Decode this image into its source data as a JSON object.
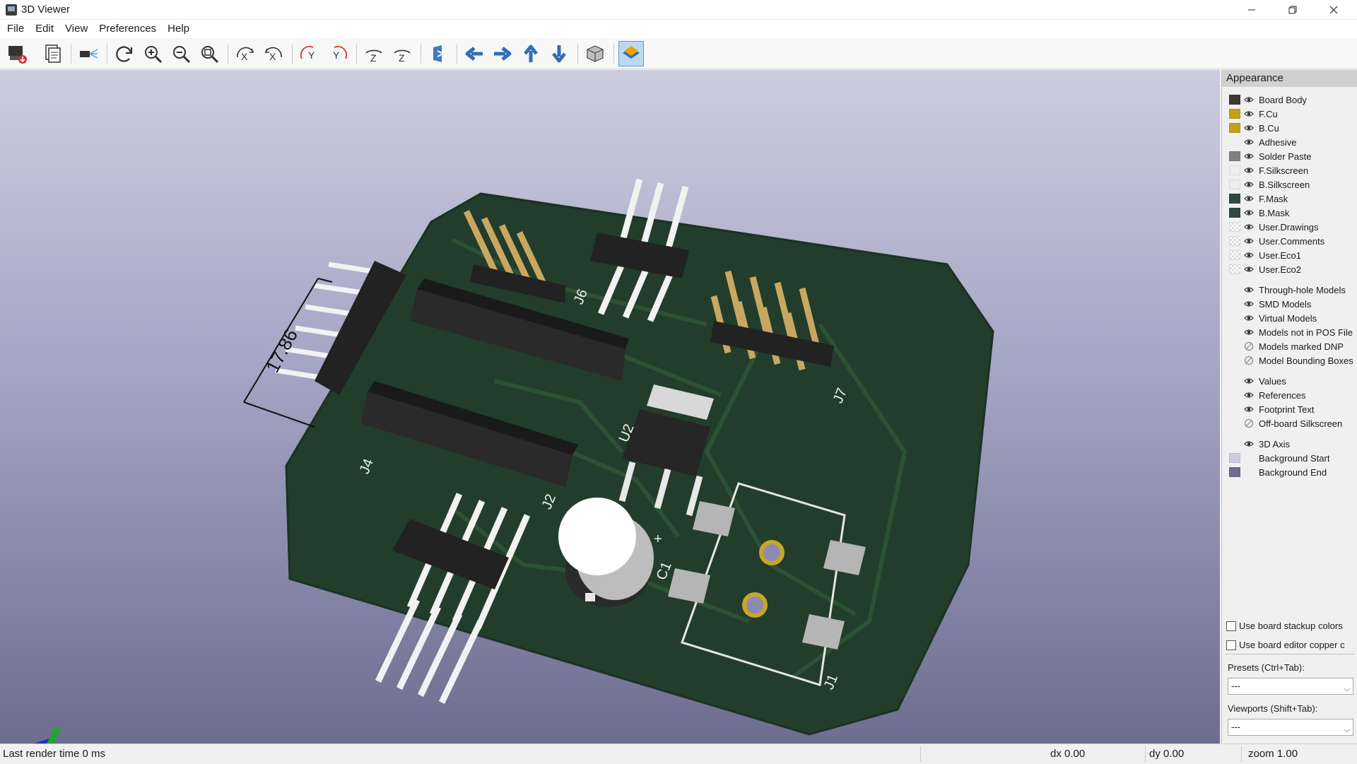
{
  "window": {
    "title": "3D Viewer"
  },
  "menu": [
    "File",
    "Edit",
    "View",
    "Preferences",
    "Help"
  ],
  "toolbar": {
    "buttons": [
      "render-raytraced-icon",
      "copy-image-icon",
      "camera-icon",
      "reload-icon",
      "zoom-in-icon",
      "zoom-out-icon",
      "zoom-fit-icon",
      "rotate-x-cw-icon",
      "rotate-x-ccw-icon",
      "rotate-y-cw-icon",
      "rotate-y-ccw-icon",
      "rotate-z-cw-icon",
      "rotate-z-ccw-icon",
      "flip-board-icon",
      "pan-left-icon",
      "pan-right-icon",
      "pan-up-icon",
      "pan-down-icon",
      "orthographic-icon",
      "layers-manager-icon"
    ]
  },
  "viewport": {
    "dimension_label": "17.86",
    "references": [
      "J6",
      "J7",
      "J4",
      "U2",
      "J2",
      "C1",
      "J1"
    ],
    "cap_polarity": "+"
  },
  "appearance": {
    "title": "Appearance",
    "layers": [
      {
        "name": "Board Body",
        "color": "#3e3a32"
      },
      {
        "name": "F.Cu",
        "color": "#c2a11c"
      },
      {
        "name": "B.Cu",
        "color": "#c2a11c"
      },
      {
        "name": "Adhesive",
        "color": ""
      },
      {
        "name": "Solder Paste",
        "color": "#808080"
      },
      {
        "name": "F.Silkscreen",
        "color": "#eeeeee"
      },
      {
        "name": "B.Silkscreen",
        "color": "#eeeeee"
      },
      {
        "name": "F.Mask",
        "color": "#2e4a3e"
      },
      {
        "name": "B.Mask",
        "color": "#2e4a3e"
      },
      {
        "name": "User.Drawings",
        "color": "checker"
      },
      {
        "name": "User.Comments",
        "color": "checker"
      },
      {
        "name": "User.Eco1",
        "color": "checker"
      },
      {
        "name": "User.Eco2",
        "color": "checker"
      }
    ],
    "models": [
      {
        "name": "Through-hole Models",
        "visible": true
      },
      {
        "name": "SMD Models",
        "visible": true
      },
      {
        "name": "Virtual Models",
        "visible": true
      },
      {
        "name": "Models not in POS File",
        "visible": true
      },
      {
        "name": "Models marked DNP",
        "visible": false
      },
      {
        "name": "Model Bounding Boxes",
        "visible": false
      }
    ],
    "text_items": [
      {
        "name": "Values",
        "visible": true
      },
      {
        "name": "References",
        "visible": true
      },
      {
        "name": "Footprint Text",
        "visible": true
      },
      {
        "name": "Off-board Silkscreen",
        "visible": false
      }
    ],
    "misc": [
      {
        "name": "3D Axis",
        "color": ""
      },
      {
        "name": "Background Start",
        "color": "#ccccdf"
      },
      {
        "name": "Background End",
        "color": "#6e6d90"
      }
    ],
    "use_stackup_colors": "Use board stackup colors",
    "use_editor_copper": "Use board editor copper c",
    "presets_label": "Presets (Ctrl+Tab):",
    "presets_value": "---",
    "viewports_label": "Viewports (Shift+Tab):",
    "viewports_value": "---"
  },
  "status": {
    "render_time": "Last render time 0 ms",
    "dx": "dx 0.00",
    "dy": "dy 0.00",
    "zoom": "zoom 1.00"
  }
}
